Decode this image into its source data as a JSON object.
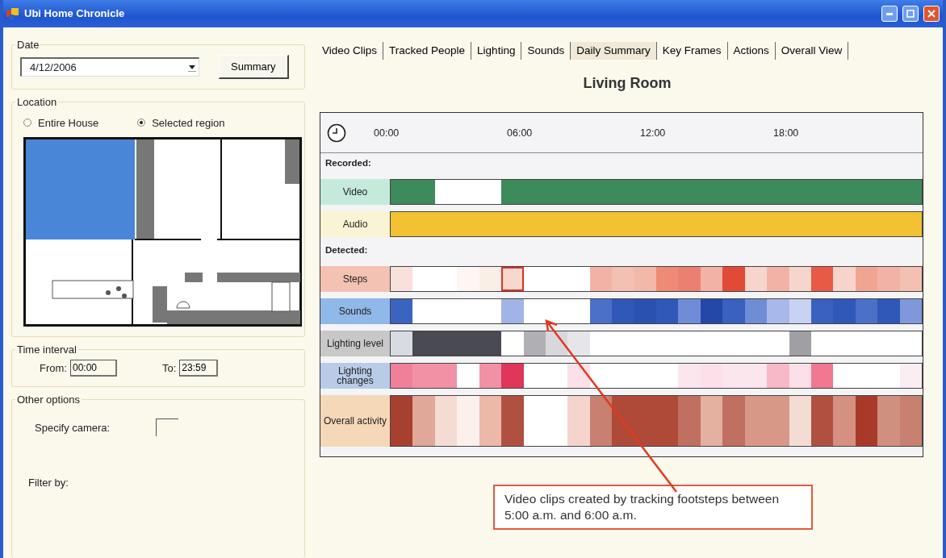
{
  "window": {
    "title": "Ubi Home Chronicle"
  },
  "date_group": {
    "legend": "Date",
    "date_value": "4/12/2006",
    "button": "Summary"
  },
  "location_group": {
    "legend": "Location",
    "options": [
      {
        "label": "Entire House",
        "selected": false
      },
      {
        "label": "Selected region",
        "selected": true
      }
    ]
  },
  "time_group": {
    "legend": "Time interval",
    "from_label": "From:",
    "from_value": "00:00",
    "to_label": "To:",
    "to_value": "23:59"
  },
  "other_group": {
    "legend": "Other options",
    "camera_label": "Specify camera:",
    "filter_label": "Filter by:"
  },
  "tabs": [
    {
      "label": "Video Clips",
      "selected": false
    },
    {
      "label": "Tracked People",
      "selected": false
    },
    {
      "label": "Lighting",
      "selected": false
    },
    {
      "label": "Sounds",
      "selected": false
    },
    {
      "label": "Daily Summary",
      "selected": true
    },
    {
      "label": "Key Frames",
      "selected": false
    },
    {
      "label": "Actions",
      "selected": false
    },
    {
      "label": "Overall View",
      "selected": false
    }
  ],
  "room_title": "Living Room",
  "timeline": {
    "ticks": [
      "00:00",
      "06:00",
      "12:00",
      "18:00"
    ],
    "rows": [
      {
        "kind": "section",
        "label": "Recorded:"
      },
      {
        "kind": "bar",
        "label": "Video",
        "color": "#c4eadc",
        "cells": [
          {
            "color": "#3d8a5a"
          },
          {
            "color": "#3d8a5a"
          },
          {
            "color": "#ffffff"
          },
          {
            "color": "#ffffff"
          },
          {
            "color": "#ffffff"
          },
          {
            "color": "#3d8a5a"
          },
          {
            "color": "#3d8a5a"
          },
          {
            "color": "#3d8a5a"
          },
          {
            "color": "#3d8a5a"
          },
          {
            "color": "#3d8a5a"
          },
          {
            "color": "#3d8a5a"
          },
          {
            "color": "#3d8a5a"
          },
          {
            "color": "#3d8a5a"
          },
          {
            "color": "#3d8a5a"
          },
          {
            "color": "#3d8a5a"
          },
          {
            "color": "#3d8a5a"
          },
          {
            "color": "#3d8a5a"
          },
          {
            "color": "#3d8a5a"
          },
          {
            "color": "#3d8a5a"
          },
          {
            "color": "#3d8a5a"
          },
          {
            "color": "#3d8a5a"
          },
          {
            "color": "#3d8a5a"
          },
          {
            "color": "#3d8a5a"
          },
          {
            "color": "#3d8a5a"
          }
        ]
      },
      {
        "kind": "bar",
        "label": "Audio",
        "color": "#fbf4d4",
        "cells": [
          {
            "color": "#f2c232"
          },
          {
            "color": "#f2c232"
          },
          {
            "color": "#f2c232"
          },
          {
            "color": "#f2c232"
          },
          {
            "color": "#f2c232"
          },
          {
            "color": "#f2c232"
          },
          {
            "color": "#f2c232"
          },
          {
            "color": "#f2c232"
          },
          {
            "color": "#f2c232"
          },
          {
            "color": "#f2c232"
          },
          {
            "color": "#f2c232"
          },
          {
            "color": "#f2c232"
          },
          {
            "color": "#f2c232"
          },
          {
            "color": "#f2c232"
          },
          {
            "color": "#f2c232"
          },
          {
            "color": "#f2c232"
          },
          {
            "color": "#f2c232"
          },
          {
            "color": "#f2c232"
          },
          {
            "color": "#f2c232"
          },
          {
            "color": "#f2c232"
          },
          {
            "color": "#f2c232"
          },
          {
            "color": "#f2c232"
          },
          {
            "color": "#f2c232"
          },
          {
            "color": "#f2c232"
          }
        ]
      },
      {
        "kind": "section",
        "label": "Detected:"
      },
      {
        "kind": "bar",
        "label": "Steps",
        "color": "#f4c2b2",
        "cells": [
          {
            "color": "#f9e0da",
            "selected": false
          },
          {
            "color": "#ffffff",
            "selected": false
          },
          {
            "color": "#ffffff",
            "selected": false
          },
          {
            "color": "#fdf6f2",
            "selected": false
          },
          {
            "color": "#faeee8",
            "selected": false
          },
          {
            "color": "#f6d8cc",
            "selected": true
          },
          {
            "color": "#ffffff",
            "selected": false
          },
          {
            "color": "#ffffff",
            "selected": false
          },
          {
            "color": "#ffffff",
            "selected": false
          },
          {
            "color": "#f2b3a6",
            "selected": false
          },
          {
            "color": "#f4c0b4",
            "selected": false
          },
          {
            "color": "#f2b8a8",
            "selected": false
          },
          {
            "color": "#ee8a76",
            "selected": false
          },
          {
            "color": "#ec8070",
            "selected": false
          },
          {
            "color": "#f2b3a6",
            "selected": false
          },
          {
            "color": "#e24a35",
            "selected": false
          },
          {
            "color": "#f7d4cc",
            "selected": false
          },
          {
            "color": "#f2b3a6",
            "selected": false
          },
          {
            "color": "#f6d6cc",
            "selected": false
          },
          {
            "color": "#e85a45",
            "selected": false
          },
          {
            "color": "#f6d4cc",
            "selected": false
          },
          {
            "color": "#f0a592",
            "selected": false
          },
          {
            "color": "#f2b3a6",
            "selected": false
          },
          {
            "color": "#f4c0b4",
            "selected": false
          }
        ]
      },
      {
        "kind": "bar",
        "label": "Sounds",
        "color": "#90b8e8",
        "cells": [
          {
            "color": "#3a64c0"
          },
          {
            "color": "#ffffff"
          },
          {
            "color": "#ffffff"
          },
          {
            "color": "#ffffff"
          },
          {
            "color": "#ffffff"
          },
          {
            "color": "#a0b4e6"
          },
          {
            "color": "#ffffff"
          },
          {
            "color": "#ffffff"
          },
          {
            "color": "#ffffff"
          },
          {
            "color": "#4a70c8"
          },
          {
            "color": "#3058b8"
          },
          {
            "color": "#2a50b0"
          },
          {
            "color": "#3058b8"
          },
          {
            "color": "#6f8cd6"
          },
          {
            "color": "#2448a8"
          },
          {
            "color": "#3a60c0"
          },
          {
            "color": "#6f8cd6"
          },
          {
            "color": "#a8b8ea"
          },
          {
            "color": "#c8d2f2"
          },
          {
            "color": "#3a60c0"
          },
          {
            "color": "#3058b8"
          },
          {
            "color": "#4a70c8"
          },
          {
            "color": "#3058b8"
          },
          {
            "color": "#7f98dc"
          }
        ]
      },
      {
        "kind": "bar",
        "label": "Lighting level",
        "color": "#c8c8c8",
        "cells": [
          {
            "color": "#d8dbe0"
          },
          {
            "color": "#4a4a52"
          },
          {
            "color": "#4a4a52"
          },
          {
            "color": "#4a4a52"
          },
          {
            "color": "#4a4a52"
          },
          {
            "color": "#ffffff"
          },
          {
            "color": "#b0b0b4"
          },
          {
            "color": "#d8d8dc"
          },
          {
            "color": "#e6e6ea"
          },
          {
            "color": "#ffffff"
          },
          {
            "color": "#ffffff"
          },
          {
            "color": "#ffffff"
          },
          {
            "color": "#ffffff"
          },
          {
            "color": "#ffffff"
          },
          {
            "color": "#ffffff"
          },
          {
            "color": "#ffffff"
          },
          {
            "color": "#ffffff"
          },
          {
            "color": "#ffffff"
          },
          {
            "color": "#a0a0a4"
          },
          {
            "color": "#ffffff"
          },
          {
            "color": "#ffffff"
          },
          {
            "color": "#ffffff"
          },
          {
            "color": "#ffffff"
          },
          {
            "color": "#ffffff"
          }
        ]
      },
      {
        "kind": "bar",
        "label": "Lighting changes",
        "color": "#b8cce8",
        "cells": [
          {
            "color": "#f0809a"
          },
          {
            "color": "#f290a6"
          },
          {
            "color": "#f290a6"
          },
          {
            "color": "#ffffff"
          },
          {
            "color": "#f290a6"
          },
          {
            "color": "#e0365a"
          },
          {
            "color": "#ffffff"
          },
          {
            "color": "#ffffff"
          },
          {
            "color": "#fbe0ea"
          },
          {
            "color": "#ffffff"
          },
          {
            "color": "#ffffff"
          },
          {
            "color": "#ffffff"
          },
          {
            "color": "#ffffff"
          },
          {
            "color": "#fbe6ee"
          },
          {
            "color": "#fbe0ea"
          },
          {
            "color": "#fbe6ee"
          },
          {
            "color": "#fbe6ee"
          },
          {
            "color": "#f7b8c8"
          },
          {
            "color": "#fbe0ea"
          },
          {
            "color": "#f07890"
          },
          {
            "color": "#ffffff"
          },
          {
            "color": "#ffffff"
          },
          {
            "color": "#ffffff"
          },
          {
            "color": "#fbeef2"
          }
        ]
      },
      {
        "kind": "tall",
        "label": "Overall activity",
        "color": "#f4d8b8",
        "cells": [
          {
            "color": "#a84030"
          },
          {
            "color": "#e0a898"
          },
          {
            "color": "#f4dcd4"
          },
          {
            "color": "#fbf0ec"
          },
          {
            "color": "#ecb8a8"
          },
          {
            "color": "#b05040"
          },
          {
            "color": "#ffffff"
          },
          {
            "color": "#ffffff"
          },
          {
            "color": "#f4d4cc"
          },
          {
            "color": "#c88070"
          },
          {
            "color": "#b04a38"
          },
          {
            "color": "#b04a38"
          },
          {
            "color": "#b04a38"
          },
          {
            "color": "#c07060"
          },
          {
            "color": "#e4b0a0"
          },
          {
            "color": "#c07060"
          },
          {
            "color": "#d89888"
          },
          {
            "color": "#d89888"
          },
          {
            "color": "#f4dcd4"
          },
          {
            "color": "#b05040"
          },
          {
            "color": "#d49080"
          },
          {
            "color": "#a83a2a"
          },
          {
            "color": "#d09080"
          },
          {
            "color": "#c88070"
          }
        ]
      }
    ]
  },
  "callout": "Video clips created by tracking footsteps between 5:00 a.m. and 6:00 a.m."
}
